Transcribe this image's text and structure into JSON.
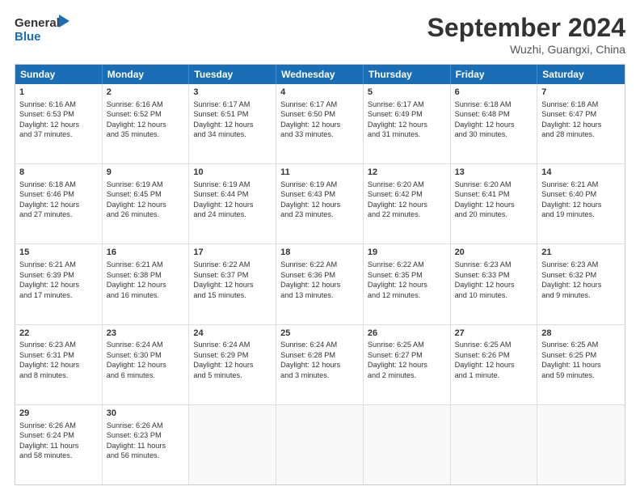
{
  "header": {
    "logo_line1": "General",
    "logo_line2": "Blue",
    "month": "September 2024",
    "location": "Wuzhi, Guangxi, China"
  },
  "days_of_week": [
    "Sunday",
    "Monday",
    "Tuesday",
    "Wednesday",
    "Thursday",
    "Friday",
    "Saturday"
  ],
  "weeks": [
    [
      {
        "day": "1",
        "lines": [
          "Sunrise: 6:16 AM",
          "Sunset: 6:53 PM",
          "Daylight: 12 hours",
          "and 37 minutes."
        ]
      },
      {
        "day": "2",
        "lines": [
          "Sunrise: 6:16 AM",
          "Sunset: 6:52 PM",
          "Daylight: 12 hours",
          "and 35 minutes."
        ]
      },
      {
        "day": "3",
        "lines": [
          "Sunrise: 6:17 AM",
          "Sunset: 6:51 PM",
          "Daylight: 12 hours",
          "and 34 minutes."
        ]
      },
      {
        "day": "4",
        "lines": [
          "Sunrise: 6:17 AM",
          "Sunset: 6:50 PM",
          "Daylight: 12 hours",
          "and 33 minutes."
        ]
      },
      {
        "day": "5",
        "lines": [
          "Sunrise: 6:17 AM",
          "Sunset: 6:49 PM",
          "Daylight: 12 hours",
          "and 31 minutes."
        ]
      },
      {
        "day": "6",
        "lines": [
          "Sunrise: 6:18 AM",
          "Sunset: 6:48 PM",
          "Daylight: 12 hours",
          "and 30 minutes."
        ]
      },
      {
        "day": "7",
        "lines": [
          "Sunrise: 6:18 AM",
          "Sunset: 6:47 PM",
          "Daylight: 12 hours",
          "and 28 minutes."
        ]
      }
    ],
    [
      {
        "day": "8",
        "lines": [
          "Sunrise: 6:18 AM",
          "Sunset: 6:46 PM",
          "Daylight: 12 hours",
          "and 27 minutes."
        ]
      },
      {
        "day": "9",
        "lines": [
          "Sunrise: 6:19 AM",
          "Sunset: 6:45 PM",
          "Daylight: 12 hours",
          "and 26 minutes."
        ]
      },
      {
        "day": "10",
        "lines": [
          "Sunrise: 6:19 AM",
          "Sunset: 6:44 PM",
          "Daylight: 12 hours",
          "and 24 minutes."
        ]
      },
      {
        "day": "11",
        "lines": [
          "Sunrise: 6:19 AM",
          "Sunset: 6:43 PM",
          "Daylight: 12 hours",
          "and 23 minutes."
        ]
      },
      {
        "day": "12",
        "lines": [
          "Sunrise: 6:20 AM",
          "Sunset: 6:42 PM",
          "Daylight: 12 hours",
          "and 22 minutes."
        ]
      },
      {
        "day": "13",
        "lines": [
          "Sunrise: 6:20 AM",
          "Sunset: 6:41 PM",
          "Daylight: 12 hours",
          "and 20 minutes."
        ]
      },
      {
        "day": "14",
        "lines": [
          "Sunrise: 6:21 AM",
          "Sunset: 6:40 PM",
          "Daylight: 12 hours",
          "and 19 minutes."
        ]
      }
    ],
    [
      {
        "day": "15",
        "lines": [
          "Sunrise: 6:21 AM",
          "Sunset: 6:39 PM",
          "Daylight: 12 hours",
          "and 17 minutes."
        ]
      },
      {
        "day": "16",
        "lines": [
          "Sunrise: 6:21 AM",
          "Sunset: 6:38 PM",
          "Daylight: 12 hours",
          "and 16 minutes."
        ]
      },
      {
        "day": "17",
        "lines": [
          "Sunrise: 6:22 AM",
          "Sunset: 6:37 PM",
          "Daylight: 12 hours",
          "and 15 minutes."
        ]
      },
      {
        "day": "18",
        "lines": [
          "Sunrise: 6:22 AM",
          "Sunset: 6:36 PM",
          "Daylight: 12 hours",
          "and 13 minutes."
        ]
      },
      {
        "day": "19",
        "lines": [
          "Sunrise: 6:22 AM",
          "Sunset: 6:35 PM",
          "Daylight: 12 hours",
          "and 12 minutes."
        ]
      },
      {
        "day": "20",
        "lines": [
          "Sunrise: 6:23 AM",
          "Sunset: 6:33 PM",
          "Daylight: 12 hours",
          "and 10 minutes."
        ]
      },
      {
        "day": "21",
        "lines": [
          "Sunrise: 6:23 AM",
          "Sunset: 6:32 PM",
          "Daylight: 12 hours",
          "and 9 minutes."
        ]
      }
    ],
    [
      {
        "day": "22",
        "lines": [
          "Sunrise: 6:23 AM",
          "Sunset: 6:31 PM",
          "Daylight: 12 hours",
          "and 8 minutes."
        ]
      },
      {
        "day": "23",
        "lines": [
          "Sunrise: 6:24 AM",
          "Sunset: 6:30 PM",
          "Daylight: 12 hours",
          "and 6 minutes."
        ]
      },
      {
        "day": "24",
        "lines": [
          "Sunrise: 6:24 AM",
          "Sunset: 6:29 PM",
          "Daylight: 12 hours",
          "and 5 minutes."
        ]
      },
      {
        "day": "25",
        "lines": [
          "Sunrise: 6:24 AM",
          "Sunset: 6:28 PM",
          "Daylight: 12 hours",
          "and 3 minutes."
        ]
      },
      {
        "day": "26",
        "lines": [
          "Sunrise: 6:25 AM",
          "Sunset: 6:27 PM",
          "Daylight: 12 hours",
          "and 2 minutes."
        ]
      },
      {
        "day": "27",
        "lines": [
          "Sunrise: 6:25 AM",
          "Sunset: 6:26 PM",
          "Daylight: 12 hours",
          "and 1 minute."
        ]
      },
      {
        "day": "28",
        "lines": [
          "Sunrise: 6:25 AM",
          "Sunset: 6:25 PM",
          "Daylight: 11 hours",
          "and 59 minutes."
        ]
      }
    ],
    [
      {
        "day": "29",
        "lines": [
          "Sunrise: 6:26 AM",
          "Sunset: 6:24 PM",
          "Daylight: 11 hours",
          "and 58 minutes."
        ]
      },
      {
        "day": "30",
        "lines": [
          "Sunrise: 6:26 AM",
          "Sunset: 6:23 PM",
          "Daylight: 11 hours",
          "and 56 minutes."
        ]
      },
      {
        "day": "",
        "lines": []
      },
      {
        "day": "",
        "lines": []
      },
      {
        "day": "",
        "lines": []
      },
      {
        "day": "",
        "lines": []
      },
      {
        "day": "",
        "lines": []
      }
    ]
  ]
}
